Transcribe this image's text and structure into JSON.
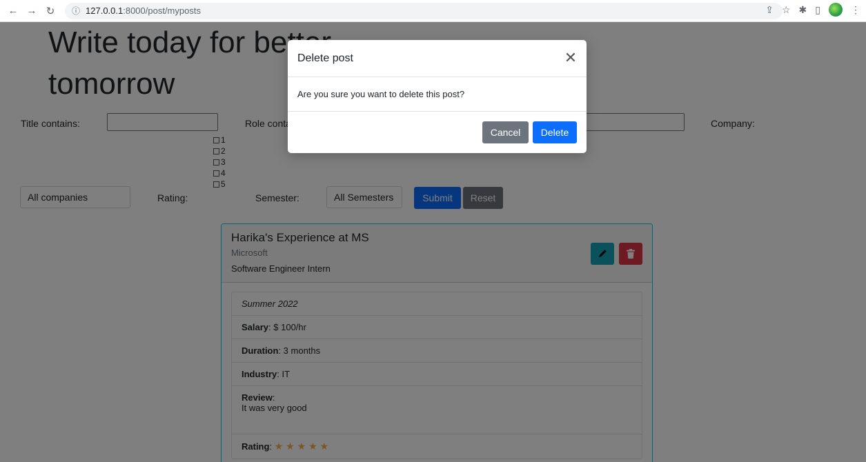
{
  "browser": {
    "url_host": "127.0.0.1",
    "url_path": ":8000/post/myposts"
  },
  "hero": {
    "line1": "Write today for better",
    "line2": "tomorrow"
  },
  "filters": {
    "title_label": "Title contains:",
    "role_label": "Role contains:",
    "company_label": "Company:",
    "company_select": "All companies",
    "rating_label": "Rating:",
    "rating_options": [
      "1",
      "2",
      "3",
      "4",
      "5"
    ],
    "semester_label": "Semester:",
    "semester_select": "All Semesters",
    "submit_label": "Submit",
    "reset_label": "Reset"
  },
  "post": {
    "title": "Harika's Experience at MS",
    "company": "Microsoft",
    "role": "Software Engineer Intern",
    "semester": "Summer 2022",
    "salary_label": "Salary",
    "salary_value": ": $ 100/hr",
    "duration_label": "Duration",
    "duration_value": ": 3 months",
    "industry_label": "Industry",
    "industry_value": ": IT",
    "review_label": "Review",
    "review_colon": ":",
    "review_value": "It was very good",
    "rating_label": "Rating",
    "rating_colon": ":",
    "rating_stars": 5
  },
  "modal": {
    "title": "Delete post",
    "body": "Are you sure you want to delete this post?",
    "cancel_label": "Cancel",
    "delete_label": "Delete"
  }
}
